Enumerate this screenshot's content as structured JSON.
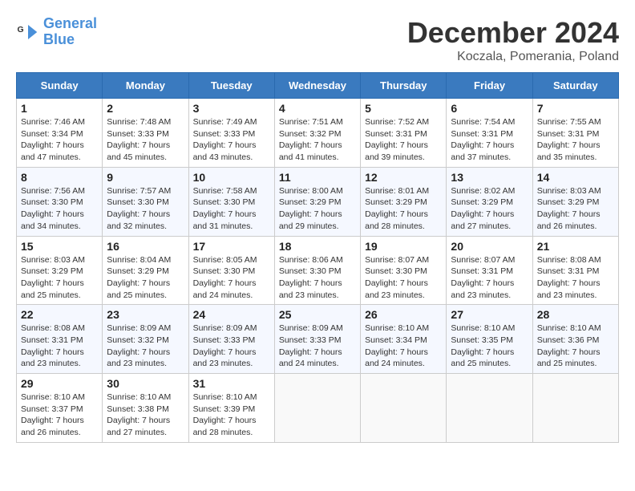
{
  "logo": {
    "text_general": "General",
    "text_blue": "Blue"
  },
  "header": {
    "month": "December 2024",
    "location": "Koczala, Pomerania, Poland"
  },
  "days_of_week": [
    "Sunday",
    "Monday",
    "Tuesday",
    "Wednesday",
    "Thursday",
    "Friday",
    "Saturday"
  ],
  "weeks": [
    [
      {
        "day": "1",
        "info": "Sunrise: 7:46 AM\nSunset: 3:34 PM\nDaylight: 7 hours\nand 47 minutes."
      },
      {
        "day": "2",
        "info": "Sunrise: 7:48 AM\nSunset: 3:33 PM\nDaylight: 7 hours\nand 45 minutes."
      },
      {
        "day": "3",
        "info": "Sunrise: 7:49 AM\nSunset: 3:33 PM\nDaylight: 7 hours\nand 43 minutes."
      },
      {
        "day": "4",
        "info": "Sunrise: 7:51 AM\nSunset: 3:32 PM\nDaylight: 7 hours\nand 41 minutes."
      },
      {
        "day": "5",
        "info": "Sunrise: 7:52 AM\nSunset: 3:31 PM\nDaylight: 7 hours\nand 39 minutes."
      },
      {
        "day": "6",
        "info": "Sunrise: 7:54 AM\nSunset: 3:31 PM\nDaylight: 7 hours\nand 37 minutes."
      },
      {
        "day": "7",
        "info": "Sunrise: 7:55 AM\nSunset: 3:31 PM\nDaylight: 7 hours\nand 35 minutes."
      }
    ],
    [
      {
        "day": "8",
        "info": "Sunrise: 7:56 AM\nSunset: 3:30 PM\nDaylight: 7 hours\nand 34 minutes."
      },
      {
        "day": "9",
        "info": "Sunrise: 7:57 AM\nSunset: 3:30 PM\nDaylight: 7 hours\nand 32 minutes."
      },
      {
        "day": "10",
        "info": "Sunrise: 7:58 AM\nSunset: 3:30 PM\nDaylight: 7 hours\nand 31 minutes."
      },
      {
        "day": "11",
        "info": "Sunrise: 8:00 AM\nSunset: 3:29 PM\nDaylight: 7 hours\nand 29 minutes."
      },
      {
        "day": "12",
        "info": "Sunrise: 8:01 AM\nSunset: 3:29 PM\nDaylight: 7 hours\nand 28 minutes."
      },
      {
        "day": "13",
        "info": "Sunrise: 8:02 AM\nSunset: 3:29 PM\nDaylight: 7 hours\nand 27 minutes."
      },
      {
        "day": "14",
        "info": "Sunrise: 8:03 AM\nSunset: 3:29 PM\nDaylight: 7 hours\nand 26 minutes."
      }
    ],
    [
      {
        "day": "15",
        "info": "Sunrise: 8:03 AM\nSunset: 3:29 PM\nDaylight: 7 hours\nand 25 minutes."
      },
      {
        "day": "16",
        "info": "Sunrise: 8:04 AM\nSunset: 3:29 PM\nDaylight: 7 hours\nand 25 minutes."
      },
      {
        "day": "17",
        "info": "Sunrise: 8:05 AM\nSunset: 3:30 PM\nDaylight: 7 hours\nand 24 minutes."
      },
      {
        "day": "18",
        "info": "Sunrise: 8:06 AM\nSunset: 3:30 PM\nDaylight: 7 hours\nand 23 minutes."
      },
      {
        "day": "19",
        "info": "Sunrise: 8:07 AM\nSunset: 3:30 PM\nDaylight: 7 hours\nand 23 minutes."
      },
      {
        "day": "20",
        "info": "Sunrise: 8:07 AM\nSunset: 3:31 PM\nDaylight: 7 hours\nand 23 minutes."
      },
      {
        "day": "21",
        "info": "Sunrise: 8:08 AM\nSunset: 3:31 PM\nDaylight: 7 hours\nand 23 minutes."
      }
    ],
    [
      {
        "day": "22",
        "info": "Sunrise: 8:08 AM\nSunset: 3:31 PM\nDaylight: 7 hours\nand 23 minutes."
      },
      {
        "day": "23",
        "info": "Sunrise: 8:09 AM\nSunset: 3:32 PM\nDaylight: 7 hours\nand 23 minutes."
      },
      {
        "day": "24",
        "info": "Sunrise: 8:09 AM\nSunset: 3:33 PM\nDaylight: 7 hours\nand 23 minutes."
      },
      {
        "day": "25",
        "info": "Sunrise: 8:09 AM\nSunset: 3:33 PM\nDaylight: 7 hours\nand 24 minutes."
      },
      {
        "day": "26",
        "info": "Sunrise: 8:10 AM\nSunset: 3:34 PM\nDaylight: 7 hours\nand 24 minutes."
      },
      {
        "day": "27",
        "info": "Sunrise: 8:10 AM\nSunset: 3:35 PM\nDaylight: 7 hours\nand 25 minutes."
      },
      {
        "day": "28",
        "info": "Sunrise: 8:10 AM\nSunset: 3:36 PM\nDaylight: 7 hours\nand 25 minutes."
      }
    ],
    [
      {
        "day": "29",
        "info": "Sunrise: 8:10 AM\nSunset: 3:37 PM\nDaylight: 7 hours\nand 26 minutes."
      },
      {
        "day": "30",
        "info": "Sunrise: 8:10 AM\nSunset: 3:38 PM\nDaylight: 7 hours\nand 27 minutes."
      },
      {
        "day": "31",
        "info": "Sunrise: 8:10 AM\nSunset: 3:39 PM\nDaylight: 7 hours\nand 28 minutes."
      },
      null,
      null,
      null,
      null
    ]
  ]
}
